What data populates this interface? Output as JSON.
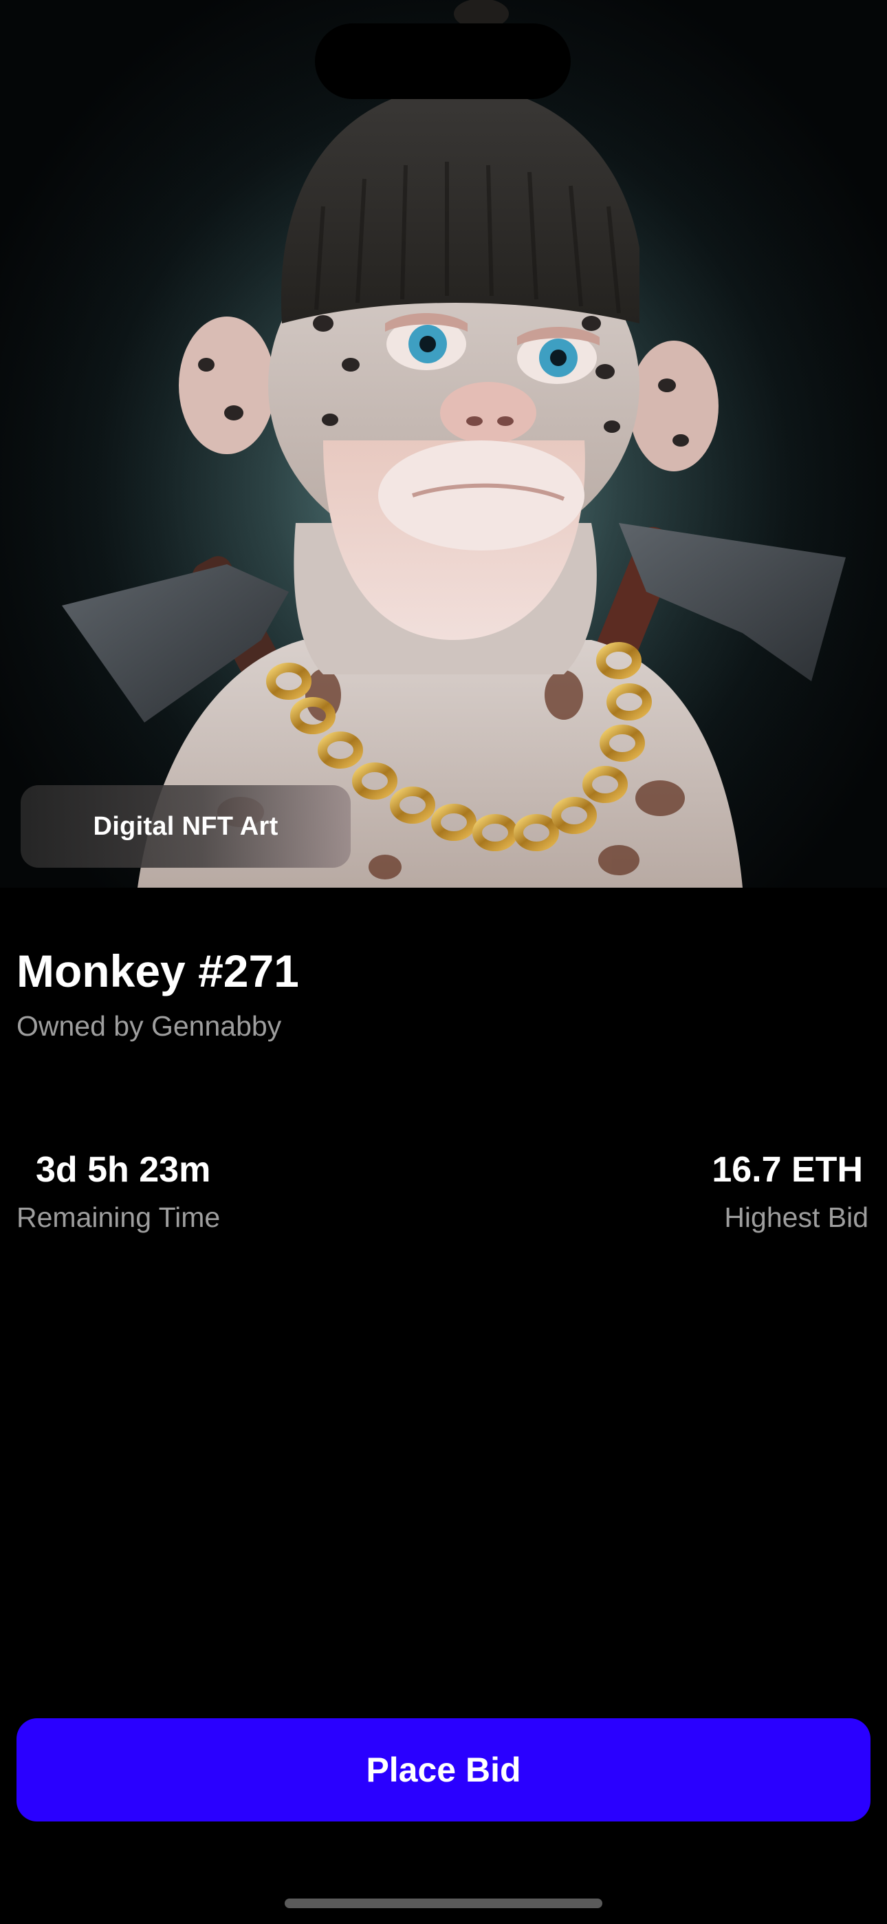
{
  "artwork": {
    "chip_label": "Digital NFT Art"
  },
  "nft": {
    "title": "Monkey #271",
    "owner": "Owned by Gennabby"
  },
  "stats": {
    "remaining_time_value": "3d 5h 23m",
    "remaining_time_label": "Remaining Time",
    "highest_bid_value": "16.7 ETH",
    "highest_bid_label": "Highest Bid"
  },
  "actions": {
    "place_bid_label": "Place Bid"
  },
  "colors": {
    "background": "#000000",
    "accent": "#2a00ff",
    "secondary_text": "#9e9e9e"
  }
}
